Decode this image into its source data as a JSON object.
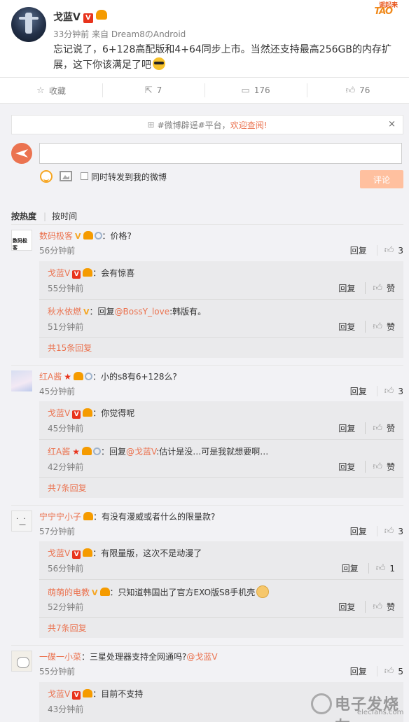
{
  "post": {
    "author": "戈蓝V",
    "meta": "33分钟前 来自 Dream8のAndroid",
    "text": "忘记说了，6+128高配版和4+64同步上市。当然还支持最高256GB的内存扩展，这下你该满足了吧",
    "logo_line1": "谣起来",
    "logo_line2": "TAO"
  },
  "actions": {
    "favorite": "收藏",
    "repost": "7",
    "comments": "176",
    "likes": "76"
  },
  "notice": {
    "prefix": "#微博辟谣#平台，",
    "link": "欢迎查阅!",
    "close": "×"
  },
  "composer": {
    "repost_label": "同时转发到我的微博",
    "submit_label": "评论"
  },
  "sort": {
    "hot": "按热度",
    "time": "按时间"
  },
  "comments": [
    {
      "name": "数码极客",
      "text": "：价格?",
      "time": "56分钟前",
      "reply": "回复",
      "likes": "3",
      "replies": [
        {
          "name": "戈蓝V",
          "text": "：会有惊喜",
          "time": "55分钟前",
          "reply": "回复",
          "likes": "赞"
        },
        {
          "name": "秋水依燃",
          "text": "：回复",
          "at": "@BossY_love",
          "rest": ":韩版有。",
          "time": "51分钟前",
          "reply": "回复",
          "likes": "赞"
        }
      ],
      "more": "共15条回复"
    },
    {
      "name": "红A酱",
      "text": "：小的s8有6+128么?",
      "time": "45分钟前",
      "reply": "回复",
      "likes": "3",
      "replies": [
        {
          "name": "戈蓝V",
          "text": "：你觉得呢",
          "time": "45分钟前",
          "reply": "回复",
          "likes": "赞"
        },
        {
          "name": "红A酱",
          "text": "：回复",
          "at": "@戈蓝V",
          "rest": ":估计是没…可是我就想要啊…",
          "time": "42分钟前",
          "reply": "回复",
          "likes": "赞"
        }
      ],
      "more": "共7条回复"
    },
    {
      "name": "宁宁宁小子",
      "text": "：有没有漫威或者什么的限量款?",
      "time": "57分钟前",
      "reply": "回复",
      "likes": "3",
      "replies": [
        {
          "name": "戈蓝V",
          "text": "：有限量版，这次不是动漫了",
          "time": "56分钟前",
          "reply": "回复",
          "likes": "1"
        },
        {
          "name": "萌萌的电教",
          "text": "：只知道韩国出了官方EXO版S8手机壳",
          "time": "52分钟前",
          "reply": "回复",
          "likes": "赞"
        }
      ],
      "more": "共7条回复"
    },
    {
      "name": "一碟一小菜",
      "text": "：三星处理器支持全网通吗?",
      "at": "@戈蓝V",
      "time": "55分钟前",
      "reply": "回复",
      "likes": "5",
      "replies": [
        {
          "name": "戈蓝V",
          "text": "：目前不支持",
          "time": "43分钟前"
        }
      ]
    }
  ],
  "watermark": {
    "main": "电子发烧友",
    "sub": "elecfans.com"
  }
}
